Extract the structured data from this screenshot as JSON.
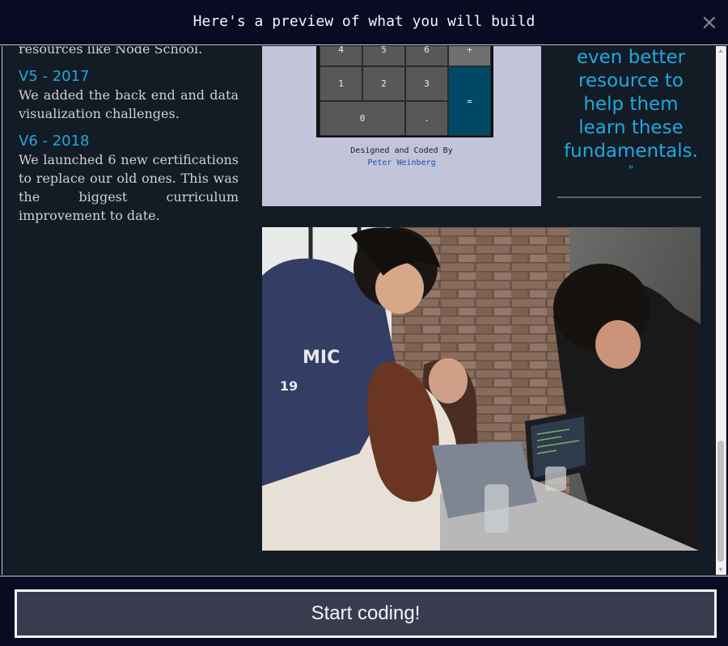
{
  "modal": {
    "title": "Here's a preview of what you will build",
    "close_icon": "×"
  },
  "preview": {
    "left_column": {
      "partial_text": "resources like Node School.",
      "entries": [
        {
          "version": "V5 - 2017",
          "text": "We added the back end and data visualization challenges."
        },
        {
          "version": "V6 - 2018",
          "text": "We launched 6 new certifications to replace our old ones. This was the biggest curriculum improvement to date."
        }
      ]
    },
    "calculator": {
      "keys": [
        "4",
        "5",
        "6",
        "+",
        "1",
        "2",
        "3",
        "=",
        "0",
        "."
      ],
      "credit_line": "Designed and Coded By",
      "credit_author": "Peter Weinberg"
    },
    "quote": {
      "lines": [
        "even better",
        "resource to",
        "help them",
        "learn these",
        "fundamentals."
      ],
      "closing_mark": "\""
    },
    "photo": {
      "shirt_text": "MIC",
      "shirt_number": "19"
    }
  },
  "footer": {
    "start_button": "Start coding!"
  },
  "colors": {
    "accent": "#1fa9e0",
    "background": "#0a0a23",
    "panel": "#131b25",
    "button": "#3b3b4f"
  }
}
